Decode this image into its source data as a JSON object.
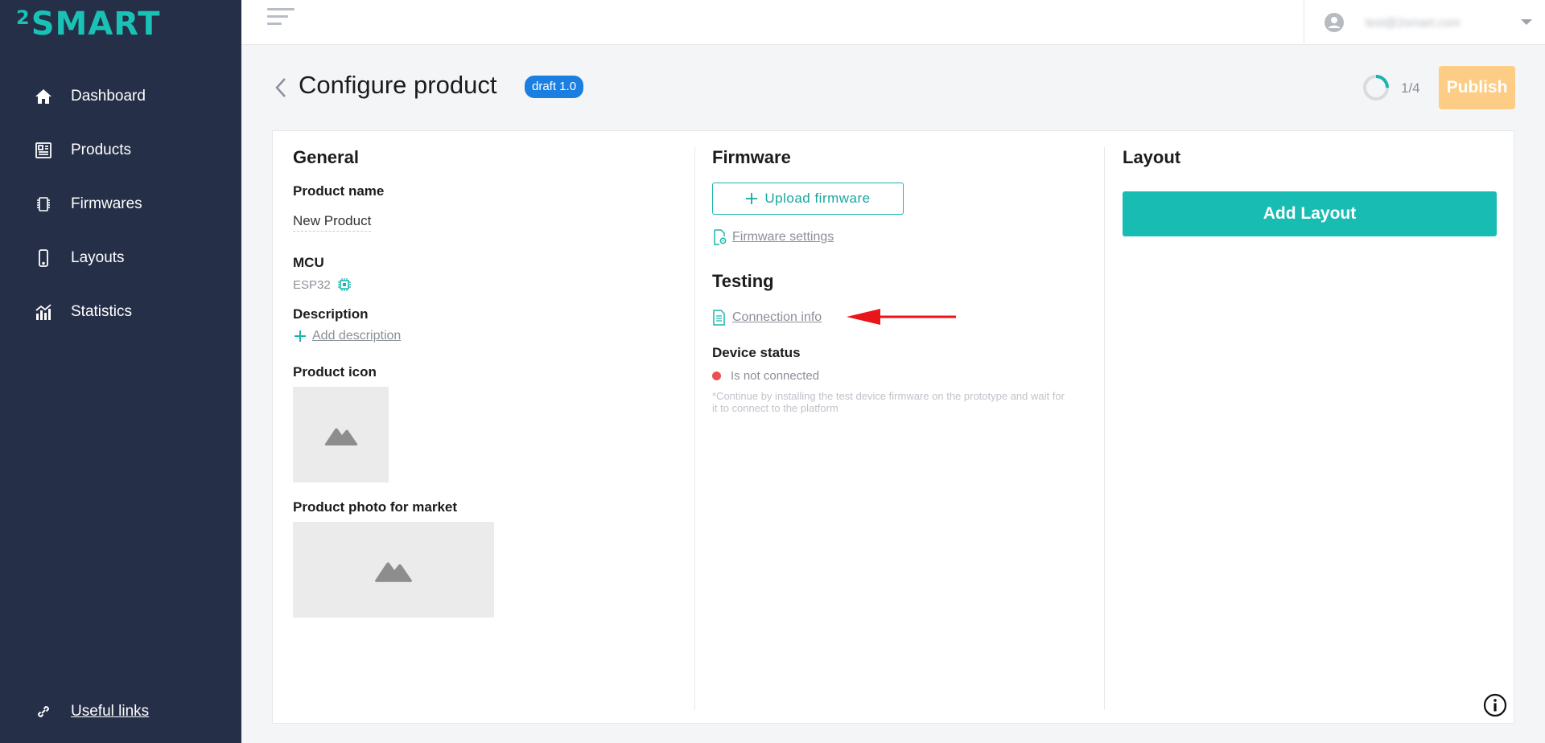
{
  "brand": {
    "sup": "2",
    "name": "SMART",
    "accent": "#19c2b4",
    "sidebar_bg": "#252f47"
  },
  "sidebar": {
    "items": [
      {
        "label": "Dashboard",
        "icon": "home-icon"
      },
      {
        "label": "Products",
        "icon": "products-icon"
      },
      {
        "label": "Firmwares",
        "icon": "chip-icon"
      },
      {
        "label": "Layouts",
        "icon": "phone-icon"
      },
      {
        "label": "Statistics",
        "icon": "chart-icon"
      }
    ],
    "useful_links": "Useful links"
  },
  "topbar": {
    "user_email": "test@2smart.com"
  },
  "header": {
    "title": "Configure product",
    "badge": "draft 1.0",
    "progress_text": "1/4",
    "progress_fraction": 0.25,
    "publish_label": "Publish"
  },
  "general": {
    "title": "General",
    "product_name_label": "Product name",
    "product_name_value": "New Product",
    "mcu_label": "MCU",
    "mcu_value": "ESP32",
    "description_label": "Description",
    "add_description": "Add description",
    "product_icon_label": "Product icon",
    "product_photo_label": "Product photo for market"
  },
  "firmware": {
    "title": "Firmware",
    "upload_label": "Upload firmware",
    "settings_label": "Firmware settings",
    "testing_title": "Testing",
    "connection_info": "Connection info",
    "device_status_label": "Device status",
    "status_text": "Is not connected",
    "hint": "*Continue by installing the test device firmware on the prototype and wait for it to connect to the platform"
  },
  "layout": {
    "title": "Layout",
    "add_label": "Add Layout"
  }
}
